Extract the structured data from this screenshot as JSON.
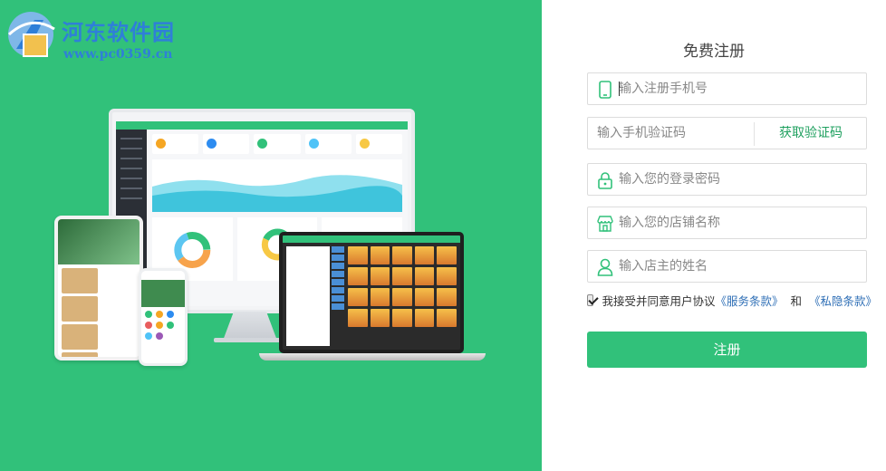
{
  "watermark": {
    "title": "河东软件园",
    "url": "www.pc0359.cn"
  },
  "register": {
    "title": "免费注册",
    "phone_placeholder": "输入注册手机号",
    "code_placeholder": "输入手机验证码",
    "get_code_label": "获取验证码",
    "password_placeholder": "输入您的登录密码",
    "shop_placeholder": "输入您的店铺名称",
    "owner_placeholder": "输入店主的姓名",
    "agree_checked": true,
    "agree_text": "我接受并同意用户协议",
    "service_terms": "《服务条款》",
    "and_text": "和",
    "privacy_terms": "《私隐条款》",
    "submit_label": "注册"
  },
  "colors": {
    "brand_green": "#31c17a",
    "link_blue": "#2f6fb6",
    "code_green": "#1fa05f"
  },
  "icons": {
    "phone": "phone-icon",
    "lock": "lock-icon",
    "shop": "shop-icon",
    "user": "user-icon"
  }
}
